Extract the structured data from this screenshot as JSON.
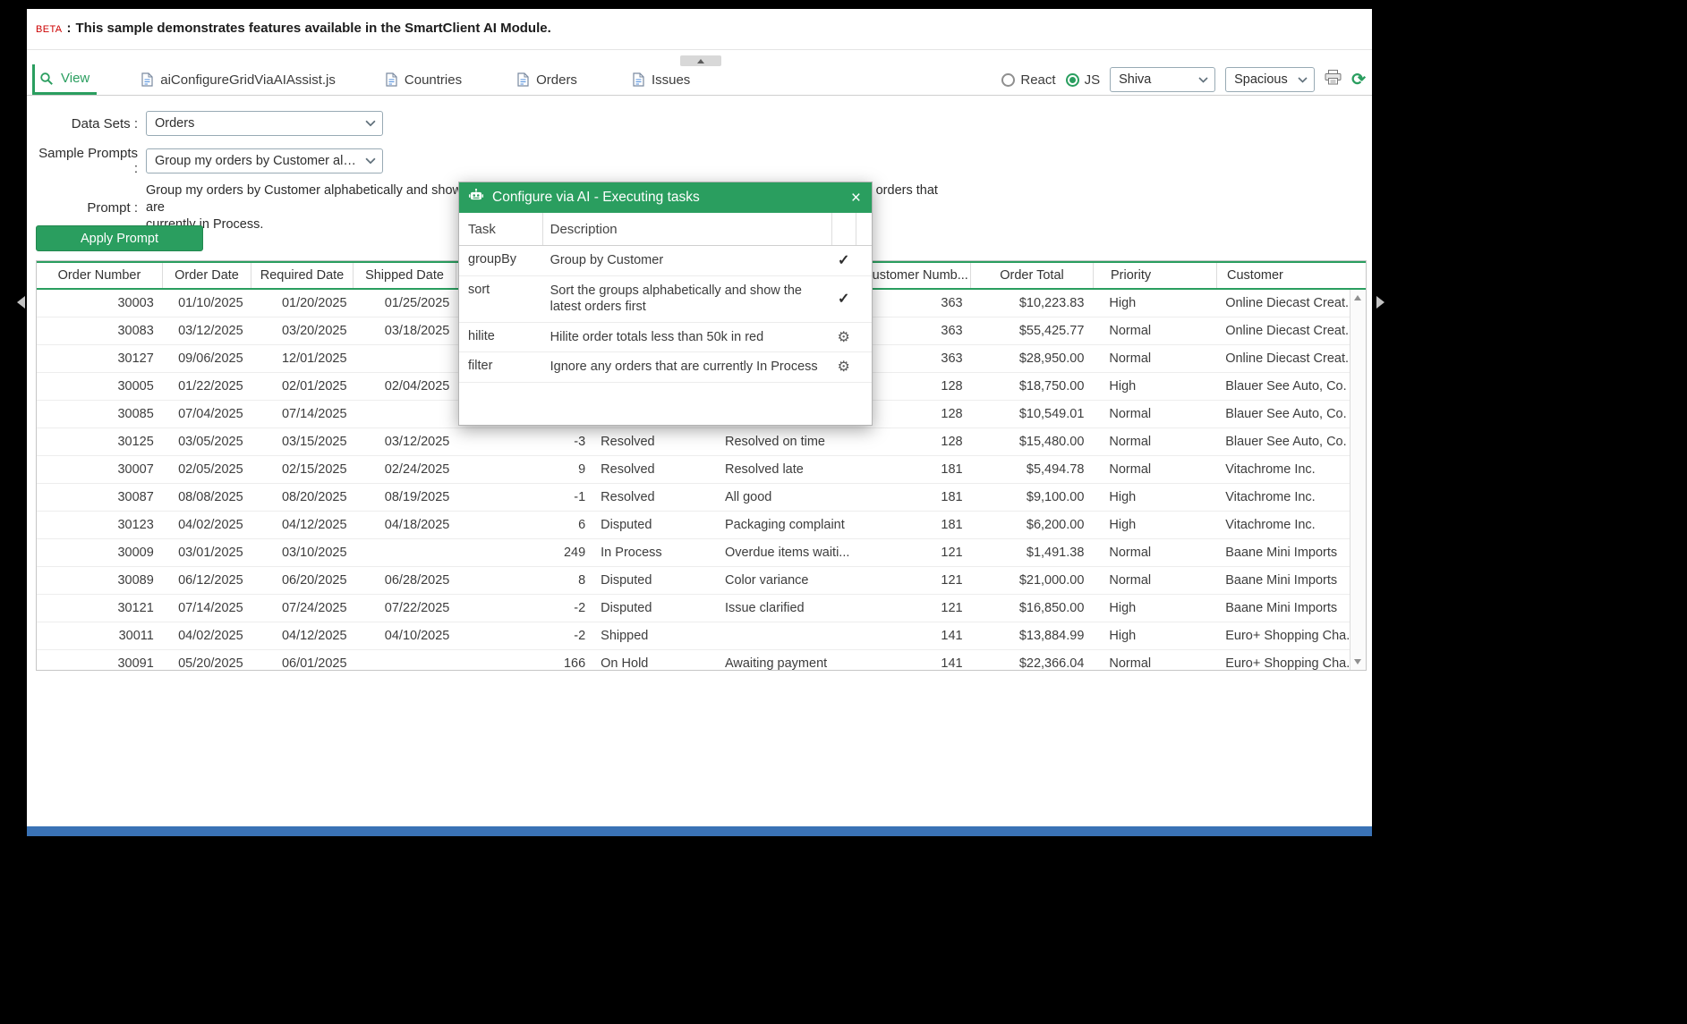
{
  "banner": {
    "beta": "BETA",
    "sep": ":",
    "message": "This sample demonstrates features available in the SmartClient AI Module."
  },
  "tabs": [
    {
      "label": "View",
      "icon": "magnifier-icon",
      "active": true
    },
    {
      "label": "aiConfigureGridViaAIAssist.js",
      "icon": "file-code-icon",
      "active": false
    },
    {
      "label": "Countries",
      "icon": "file-code-icon",
      "active": false
    },
    {
      "label": "Orders",
      "icon": "file-code-icon",
      "active": false
    },
    {
      "label": "Issues",
      "icon": "file-code-icon",
      "active": false
    }
  ],
  "toolbar": {
    "framework_options": [
      {
        "label": "React",
        "selected": false
      },
      {
        "label": "JS",
        "selected": true
      }
    ],
    "skin_value": "Shiva",
    "density_value": "Spacious",
    "icons": [
      "printer-icon",
      "sync-icon",
      "chevron-down-icon"
    ]
  },
  "form": {
    "data_sets_label": "Data Sets :",
    "data_sets_value": "Orders",
    "sample_prompts_label": "Sample Prompts :",
    "sample_prompts_value": "Group my orders by Customer alphab...",
    "prompt_label": "Prompt :",
    "prompt_text": "Group my orders by Customer alphabetically and show the latest orders first. Hilite order totals less than 50k in red. Ignore any orders that are\ncurrently in Process.",
    "apply_button_label": "Apply Prompt"
  },
  "dialog": {
    "icon": "robot-icon",
    "title": "Configure via AI - Executing tasks",
    "close_icon": "close-icon",
    "columns": {
      "task": "Task",
      "description": "Description"
    },
    "tasks": [
      {
        "task": "groupBy",
        "description": "Group by Customer",
        "status": "done",
        "status_icon": "check-icon"
      },
      {
        "task": "sort",
        "description": "Sort the groups alphabetically and show the latest orders first",
        "status": "done",
        "status_icon": "check-icon"
      },
      {
        "task": "hilite",
        "description": "Hilite order totals less than 50k in red",
        "status": "running",
        "status_icon": "gear-icon"
      },
      {
        "task": "filter",
        "description": "Ignore any orders that are currently In Process",
        "status": "running",
        "status_icon": "gear-icon"
      }
    ]
  },
  "grid": {
    "columns": [
      "Order Number",
      "Order Date",
      "Required Date",
      "Shipped Date",
      "",
      "",
      "",
      "Customer Numb...",
      "Order Total",
      "Priority",
      "Customer"
    ],
    "rows": [
      [
        "30003",
        "01/10/2025",
        "01/20/2025",
        "01/25/2025",
        "",
        "",
        "",
        "363",
        "$10,223.83",
        "High",
        "Online Diecast Creat..."
      ],
      [
        "30083",
        "03/12/2025",
        "03/20/2025",
        "03/18/2025",
        "",
        "",
        "",
        "363",
        "$55,425.77",
        "Normal",
        "Online Diecast Creat..."
      ],
      [
        "30127",
        "09/06/2025",
        "12/01/2025",
        "",
        "",
        "",
        "",
        "363",
        "$28,950.00",
        "Normal",
        "Online Diecast Creat..."
      ],
      [
        "30005",
        "01/22/2025",
        "02/01/2025",
        "02/04/2025",
        "",
        "",
        "",
        "128",
        "$18,750.00",
        "High",
        "Blauer See Auto, Co."
      ],
      [
        "30085",
        "07/04/2025",
        "07/14/2025",
        "",
        "",
        "",
        "",
        "128",
        "$10,549.01",
        "Normal",
        "Blauer See Auto, Co."
      ],
      [
        "30125",
        "03/05/2025",
        "03/15/2025",
        "03/12/2025",
        "-3",
        "Resolved",
        "Resolved on time",
        "128",
        "$15,480.00",
        "Normal",
        "Blauer See Auto, Co."
      ],
      [
        "30007",
        "02/05/2025",
        "02/15/2025",
        "02/24/2025",
        "9",
        "Resolved",
        "Resolved late",
        "181",
        "$5,494.78",
        "Normal",
        "Vitachrome Inc."
      ],
      [
        "30087",
        "08/08/2025",
        "08/20/2025",
        "08/19/2025",
        "-1",
        "Resolved",
        "All good",
        "181",
        "$9,100.00",
        "High",
        "Vitachrome Inc."
      ],
      [
        "30123",
        "04/02/2025",
        "04/12/2025",
        "04/18/2025",
        "6",
        "Disputed",
        "Packaging complaint",
        "181",
        "$6,200.00",
        "High",
        "Vitachrome Inc."
      ],
      [
        "30009",
        "03/01/2025",
        "03/10/2025",
        "",
        "249",
        "In Process",
        "Overdue items waiti...",
        "121",
        "$1,491.38",
        "Normal",
        "Baane Mini Imports"
      ],
      [
        "30089",
        "06/12/2025",
        "06/20/2025",
        "06/28/2025",
        "8",
        "Disputed",
        "Color variance",
        "121",
        "$21,000.00",
        "Normal",
        "Baane Mini Imports"
      ],
      [
        "30121",
        "07/14/2025",
        "07/24/2025",
        "07/22/2025",
        "-2",
        "Disputed",
        "Issue clarified",
        "121",
        "$16,850.00",
        "High",
        "Baane Mini Imports"
      ],
      [
        "30011",
        "04/02/2025",
        "04/12/2025",
        "04/10/2025",
        "-2",
        "Shipped",
        "",
        "141",
        "$13,884.99",
        "High",
        "Euro+ Shopping Cha..."
      ],
      [
        "30091",
        "05/20/2025",
        "06/01/2025",
        "",
        "166",
        "On Hold",
        "Awaiting payment",
        "141",
        "$22,366.04",
        "Normal",
        "Euro+ Shopping Cha..."
      ]
    ]
  },
  "colors": {
    "accent_green": "#2a9e5f",
    "beta_red": "#cc0000",
    "bottom_bar_blue": "#3a72b5"
  }
}
